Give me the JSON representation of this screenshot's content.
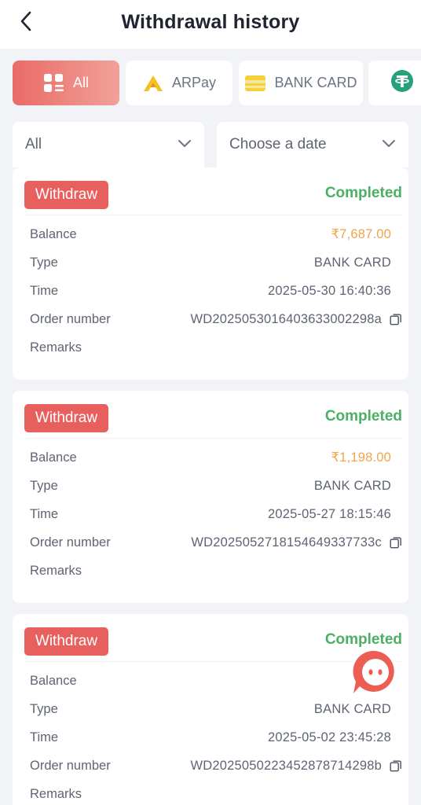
{
  "header": {
    "title": "Withdrawal history",
    "back_icon": "chevron-left-icon"
  },
  "tabs": [
    {
      "label": "All",
      "icon": "grid-icon",
      "active": true
    },
    {
      "label": "ARPay",
      "icon": "arpay-logo-icon",
      "active": false
    },
    {
      "label": "BANK CARD",
      "icon": "bank-card-icon",
      "active": false
    },
    {
      "label": "",
      "icon": "tether-icon",
      "active": false
    }
  ],
  "filters": {
    "type_select": {
      "value": "All"
    },
    "date_select": {
      "value": "Choose a date"
    }
  },
  "labels": {
    "badge": "Withdraw",
    "balance": "Balance",
    "type": "Type",
    "time": "Time",
    "order_number": "Order number",
    "remarks": "Remarks"
  },
  "records": [
    {
      "status": "Completed",
      "balance": "₹7,687.00",
      "type": "BANK CARD",
      "time": "2025-05-30 16:40:36",
      "order_number": "WD2025053016403633002298a",
      "remarks": ""
    },
    {
      "status": "Completed",
      "balance": "₹1,198.00",
      "type": "BANK CARD",
      "time": "2025-05-27 18:15:46",
      "order_number": "WD2025052718154649337733c",
      "remarks": ""
    },
    {
      "status": "Completed",
      "balance": "",
      "type": "BANK CARD",
      "time": "2025-05-02 23:45:28",
      "order_number": "WD2025050223452878714298b",
      "remarks": ""
    }
  ],
  "colors": {
    "accent": "#e8605d",
    "completed": "#4bb064",
    "money": "#f1a54a",
    "background": "#f2f3f7"
  }
}
